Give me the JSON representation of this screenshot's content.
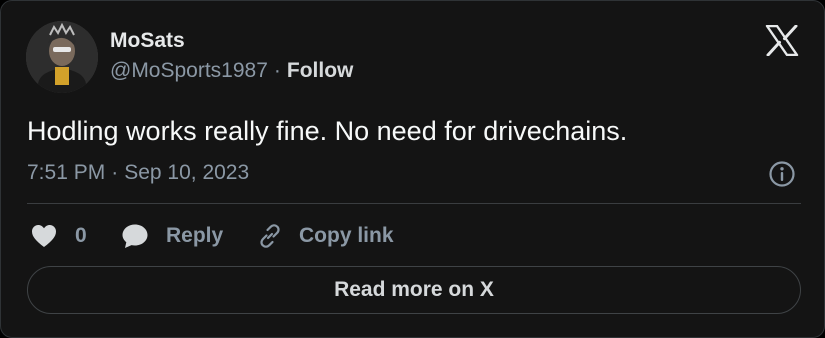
{
  "author": {
    "name": "MoSats",
    "handle": "@MoSports1987",
    "separator": "·",
    "follow_label": "Follow"
  },
  "tweet": {
    "text": "Hodling works really fine. No need for drivechains.",
    "time": "7:51 PM",
    "separator": "·",
    "date": "Sep 10, 2023"
  },
  "actions": {
    "like_count": "0",
    "reply_label": "Reply",
    "copy_link_label": "Copy link"
  },
  "footer": {
    "read_more_label": "Read more on X"
  },
  "icons": {
    "brand": "x-logo-icon",
    "info": "info-icon",
    "like": "heart-icon",
    "reply": "speech-bubble-icon",
    "copy": "link-icon"
  },
  "colors": {
    "background": "#141414",
    "primary_text": "#e7e9ea",
    "secondary_text": "#8b98a5",
    "border": "#2f3336"
  }
}
